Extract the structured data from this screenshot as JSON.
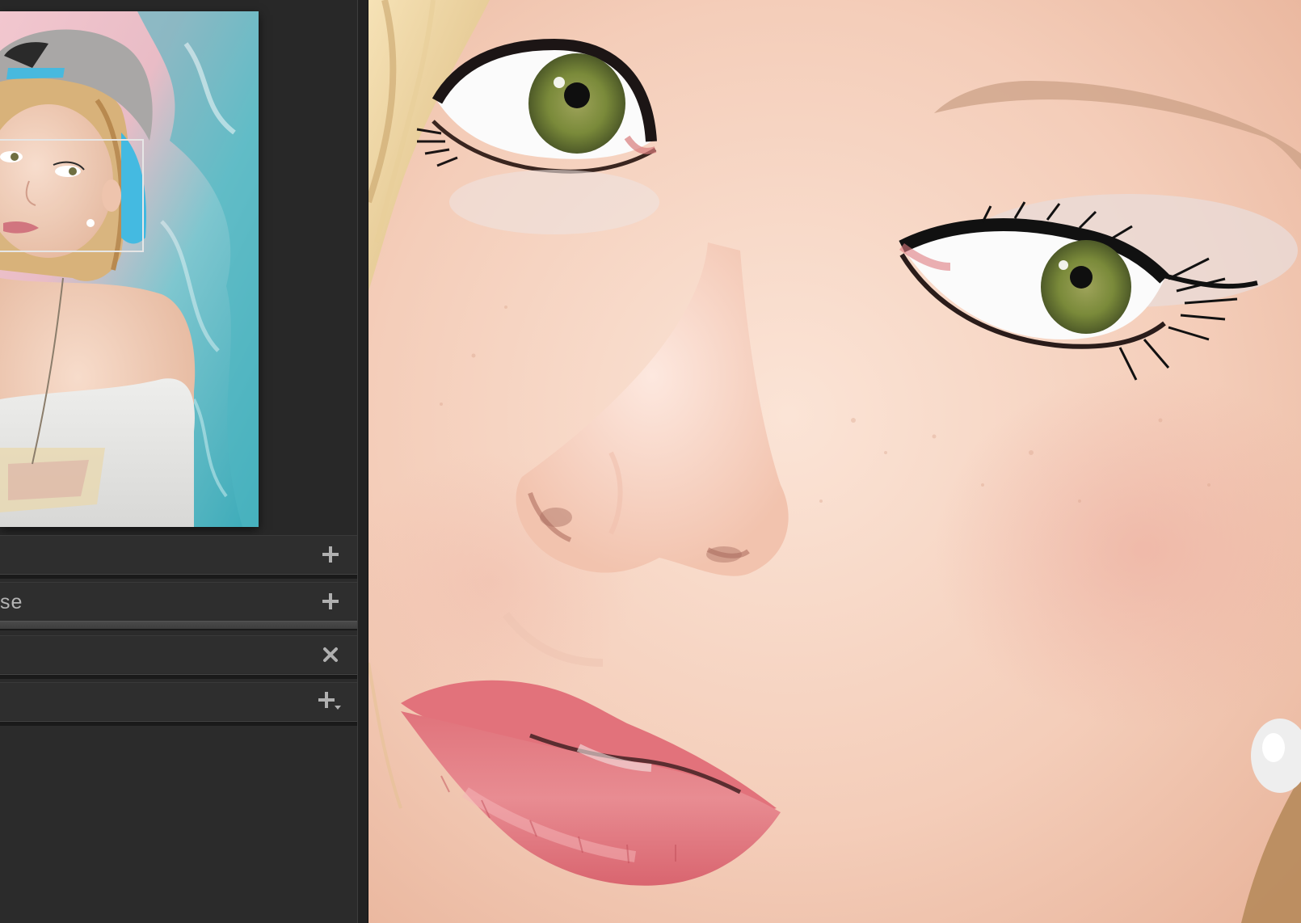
{
  "panels": {
    "row1": {
      "label": "",
      "action": "+"
    },
    "row2": {
      "label": "se",
      "action": "+"
    },
    "row3": {
      "label": "",
      "action": "✕"
    },
    "row4": {
      "label": "",
      "action": "+"
    }
  },
  "icons": {
    "row1": "plus-icon",
    "row2": "plus-icon",
    "row3": "close-icon",
    "row4": "plus-dropdown-icon"
  },
  "colors": {
    "panel_bg": "#2b2b2b",
    "icon": "#b0b0b0",
    "nav_box": "#e6e6e6"
  }
}
